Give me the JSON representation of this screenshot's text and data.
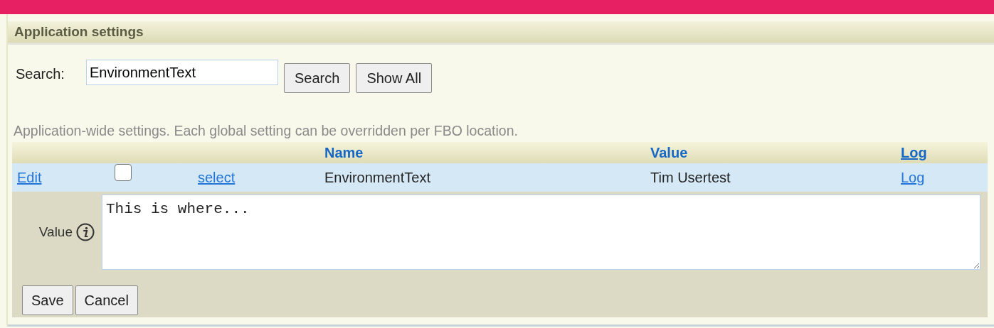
{
  "panel": {
    "title": "Application settings"
  },
  "search": {
    "label": "Search:",
    "value": "EnvironmentText",
    "buttons": [
      "Search",
      "Show All"
    ]
  },
  "description": "Application-wide settings. Each global setting can be overridden per FBO location.",
  "table": {
    "columns": [
      {
        "label": "Name",
        "link": false
      },
      {
        "label": "Value",
        "link": false
      },
      {
        "label": "Log",
        "link": true
      }
    ],
    "rows": [
      {
        "edit": "Edit",
        "checked": false,
        "select": "select",
        "name": "EnvironmentText",
        "value": "Tim Usertest",
        "log": "Log",
        "selected": true
      }
    ]
  },
  "editor": {
    "label": "Value",
    "value": "This is where...",
    "buttons": [
      "Save",
      "Cancel"
    ]
  }
}
